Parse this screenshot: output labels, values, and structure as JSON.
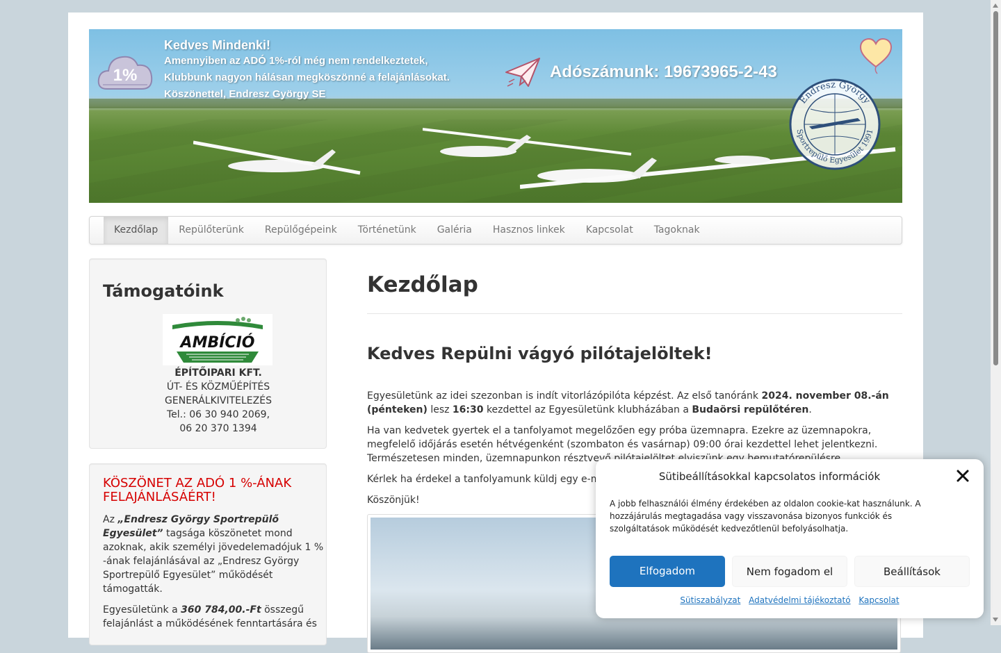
{
  "banner": {
    "cloud_text": "1%",
    "greeting_title": "Kedves Mindenki!",
    "greeting_lines": [
      "Amennyiben az ADÓ 1%-ról még nem rendelkeztetek,",
      "Klubbunk nagyon hálásan megköszönné a felajánlásokat.",
      "Köszönettel, Endresz György SE"
    ],
    "tax_id": "Adószámunk: 19673965-2-43",
    "logo_text_top": "Endresz György",
    "logo_text_bottom": "Sportrepülő Egyesület 1991",
    "icons": [
      "cloud-icon",
      "paper-plane-icon",
      "heart-icon"
    ]
  },
  "nav": {
    "items": [
      {
        "label": "Kezdőlap",
        "active": true
      },
      {
        "label": "Repülőterünk",
        "active": false
      },
      {
        "label": "Repülőgépeink",
        "active": false
      },
      {
        "label": "Történetünk",
        "active": false
      },
      {
        "label": "Galéria",
        "active": false
      },
      {
        "label": "Hasznos linkek",
        "active": false
      },
      {
        "label": "Kapcsolat",
        "active": false
      },
      {
        "label": "Tagoknak",
        "active": false
      }
    ]
  },
  "sidebar": {
    "sponsors": {
      "title": "Támogatóink",
      "logo_text": "AMBÍCIÓ",
      "lines": [
        "ÉPÍTŐIPARI KFT.",
        "ÚT- ÉS KÖZMŰÉPÍTÉS",
        "GENERÁLKIVITELEZÉS",
        "Tel.: 06 30 940 2069,",
        "06 20 370 1394"
      ]
    },
    "thanks": {
      "title": "KÖSZÖNET AZ ADÓ 1 %-ÁNAK FELAJÁNLÁSÁÉRT!",
      "p1_prefix": "Az ",
      "p1_bold": "„Endresz György Sportrepülő Egyesület”",
      "p1_rest": " tagsága köszönetet mond azoknak, akik személyi jövedelemadójuk 1 % -ának felajánlásával az „Endresz György Sportrepülő Egyesület” működését támogatták.",
      "p2_prefix": "Egyesületünk a ",
      "p2_bold": "360 784,00.-Ft",
      "p2_rest": " összegű felajánlást a működésének fenntartására és"
    }
  },
  "main": {
    "page_title": "Kezdőlap",
    "heading": "Kedves Repülni vágyó pilótajelöltek!",
    "p1": {
      "t1": "Egyesületünk az idei szezonban is indít vitorlázópilóta képzést. Az első tanóránk ",
      "b1": "2024. november 08.-án (pénteken)",
      "t2": " lesz ",
      "b2": "16:30",
      "t3": " kezdettel az Egyesületünk klubházában a ",
      "b3": "Budaörsi repülőtéren",
      "t4": "."
    },
    "p2": "Ha van kedvetek gyertek el a tanfolyamot megelőzően egy próba üzemnapra. Ezekre az üzemnapokra, megfelelő időjárás esetén hétvégenként (szombaton és vasárnap) 09:00 órai kezdettel lehet jelentkezni. Természetesen minden, üzemnapunkon résztvevő pilótajelöltet elviszünk egy bemutatórepülésre.",
    "p3": "Kérlek ha érdekel a tanfolyamunk küldj egy e-m",
    "p4": "Köszönjük!"
  },
  "cookie": {
    "title": "Sütibeállításokkal kapcsolatos információk",
    "text": "A jobb felhasználói élmény érdekében az oldalon cookie-kat használunk. A hozzájárulás megtagadása vagy visszavonása bizonyos funkciók és szolgáltatások működését kedvezőtlenül befolyásolhatja.",
    "accept": "Elfogadom",
    "deny": "Nem fogadom el",
    "settings": "Beállítások",
    "links": [
      "Sütiszabályzat",
      "Adatvédelmi tájékoztató",
      "Kapcsolat"
    ],
    "accent_color": "#1e73be"
  }
}
